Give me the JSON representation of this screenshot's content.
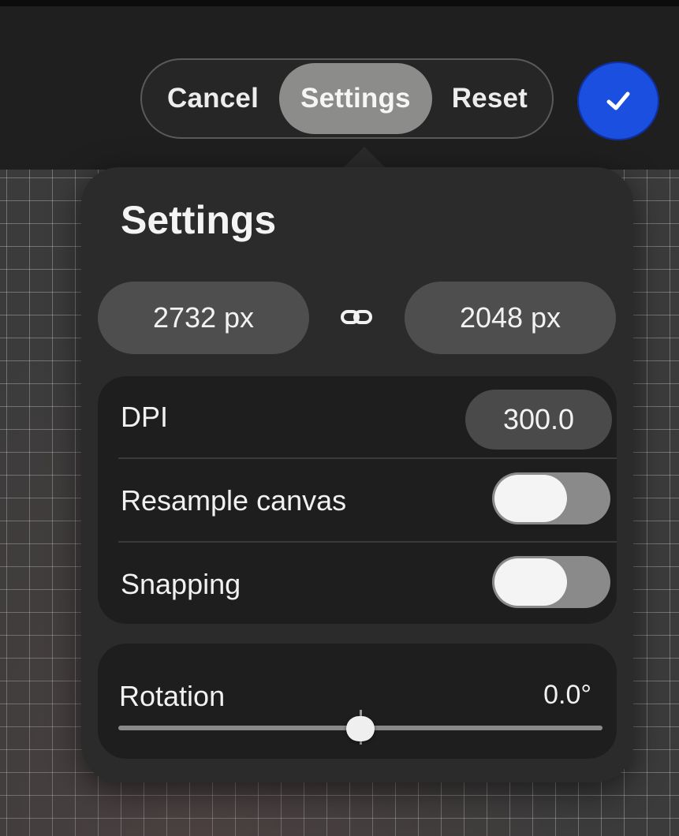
{
  "toolbar": {
    "cancel_label": "Cancel",
    "settings_label": "Settings",
    "reset_label": "Reset",
    "confirm_icon": "checkmark-icon",
    "confirm_color": "#1a4fe0"
  },
  "panel": {
    "title": "Settings",
    "width_value": "2732 px",
    "height_value": "2048 px",
    "link_icon": "chain-link-icon",
    "dpi": {
      "label": "DPI",
      "value": "300.0"
    },
    "resample": {
      "label": "Resample canvas",
      "enabled": false
    },
    "snapping": {
      "label": "Snapping",
      "enabled": false
    },
    "rotation": {
      "label": "Rotation",
      "value": "0.0°",
      "slider_fraction": 0.5
    }
  }
}
